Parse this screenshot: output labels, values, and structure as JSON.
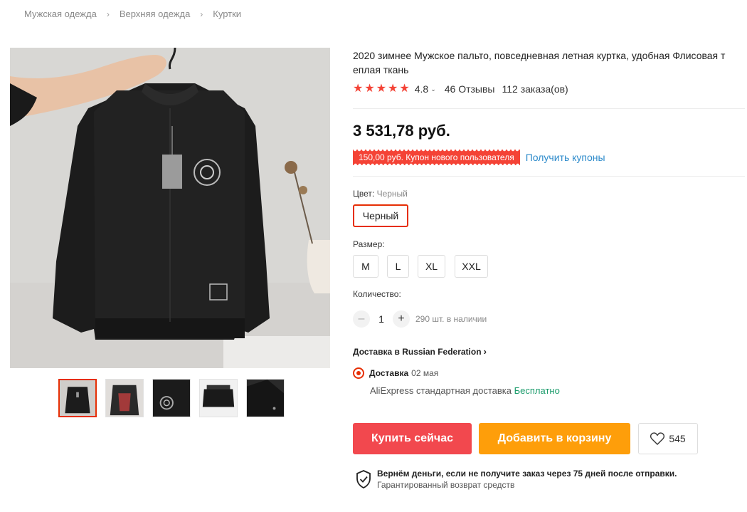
{
  "breadcrumb": [
    "Мужская одежда",
    "Верхняя одежда",
    "Куртки"
  ],
  "product": {
    "title": "2020 зимнее Мужское пальто, повседневная летная куртка, удобная Флисовая т еплая ткань",
    "rating": "4.8",
    "reviews": "46 Отзывы",
    "orders": "112 заказа(ов)",
    "price": "3 531,78 руб.",
    "coupon": "150,00 руб. Купон нового пользователя",
    "coupon_link": "Получить купоны"
  },
  "color": {
    "label": "Цвет:",
    "selected_name": "Черный",
    "options": [
      "Черный"
    ]
  },
  "size": {
    "label": "Размер:",
    "options": [
      "M",
      "L",
      "XL",
      "XXL"
    ]
  },
  "quantity": {
    "label": "Количество:",
    "value": "1",
    "minus": "–",
    "plus": "+",
    "stock": "290 шт. в наличии"
  },
  "shipping": {
    "title": "Доставка в Russian Federation",
    "option_label": "Доставка",
    "option_date": "02 мая",
    "service": "AliExpress стандартная доставка",
    "price": "Бесплатно"
  },
  "actions": {
    "buy": "Купить сейчас",
    "cart": "Добавить в корзину",
    "wishlist_count": "545"
  },
  "guarantee": {
    "title": "Вернём деньги, если не получите заказ через 75 дней после отправки.",
    "subtitle": "Гарантированный возврат средств"
  },
  "colors": {
    "accent": "#e62e04",
    "buy": "#f2484e",
    "cart": "#fe9e0a",
    "link": "#2e8bcb",
    "free": "#1a9b6b"
  }
}
